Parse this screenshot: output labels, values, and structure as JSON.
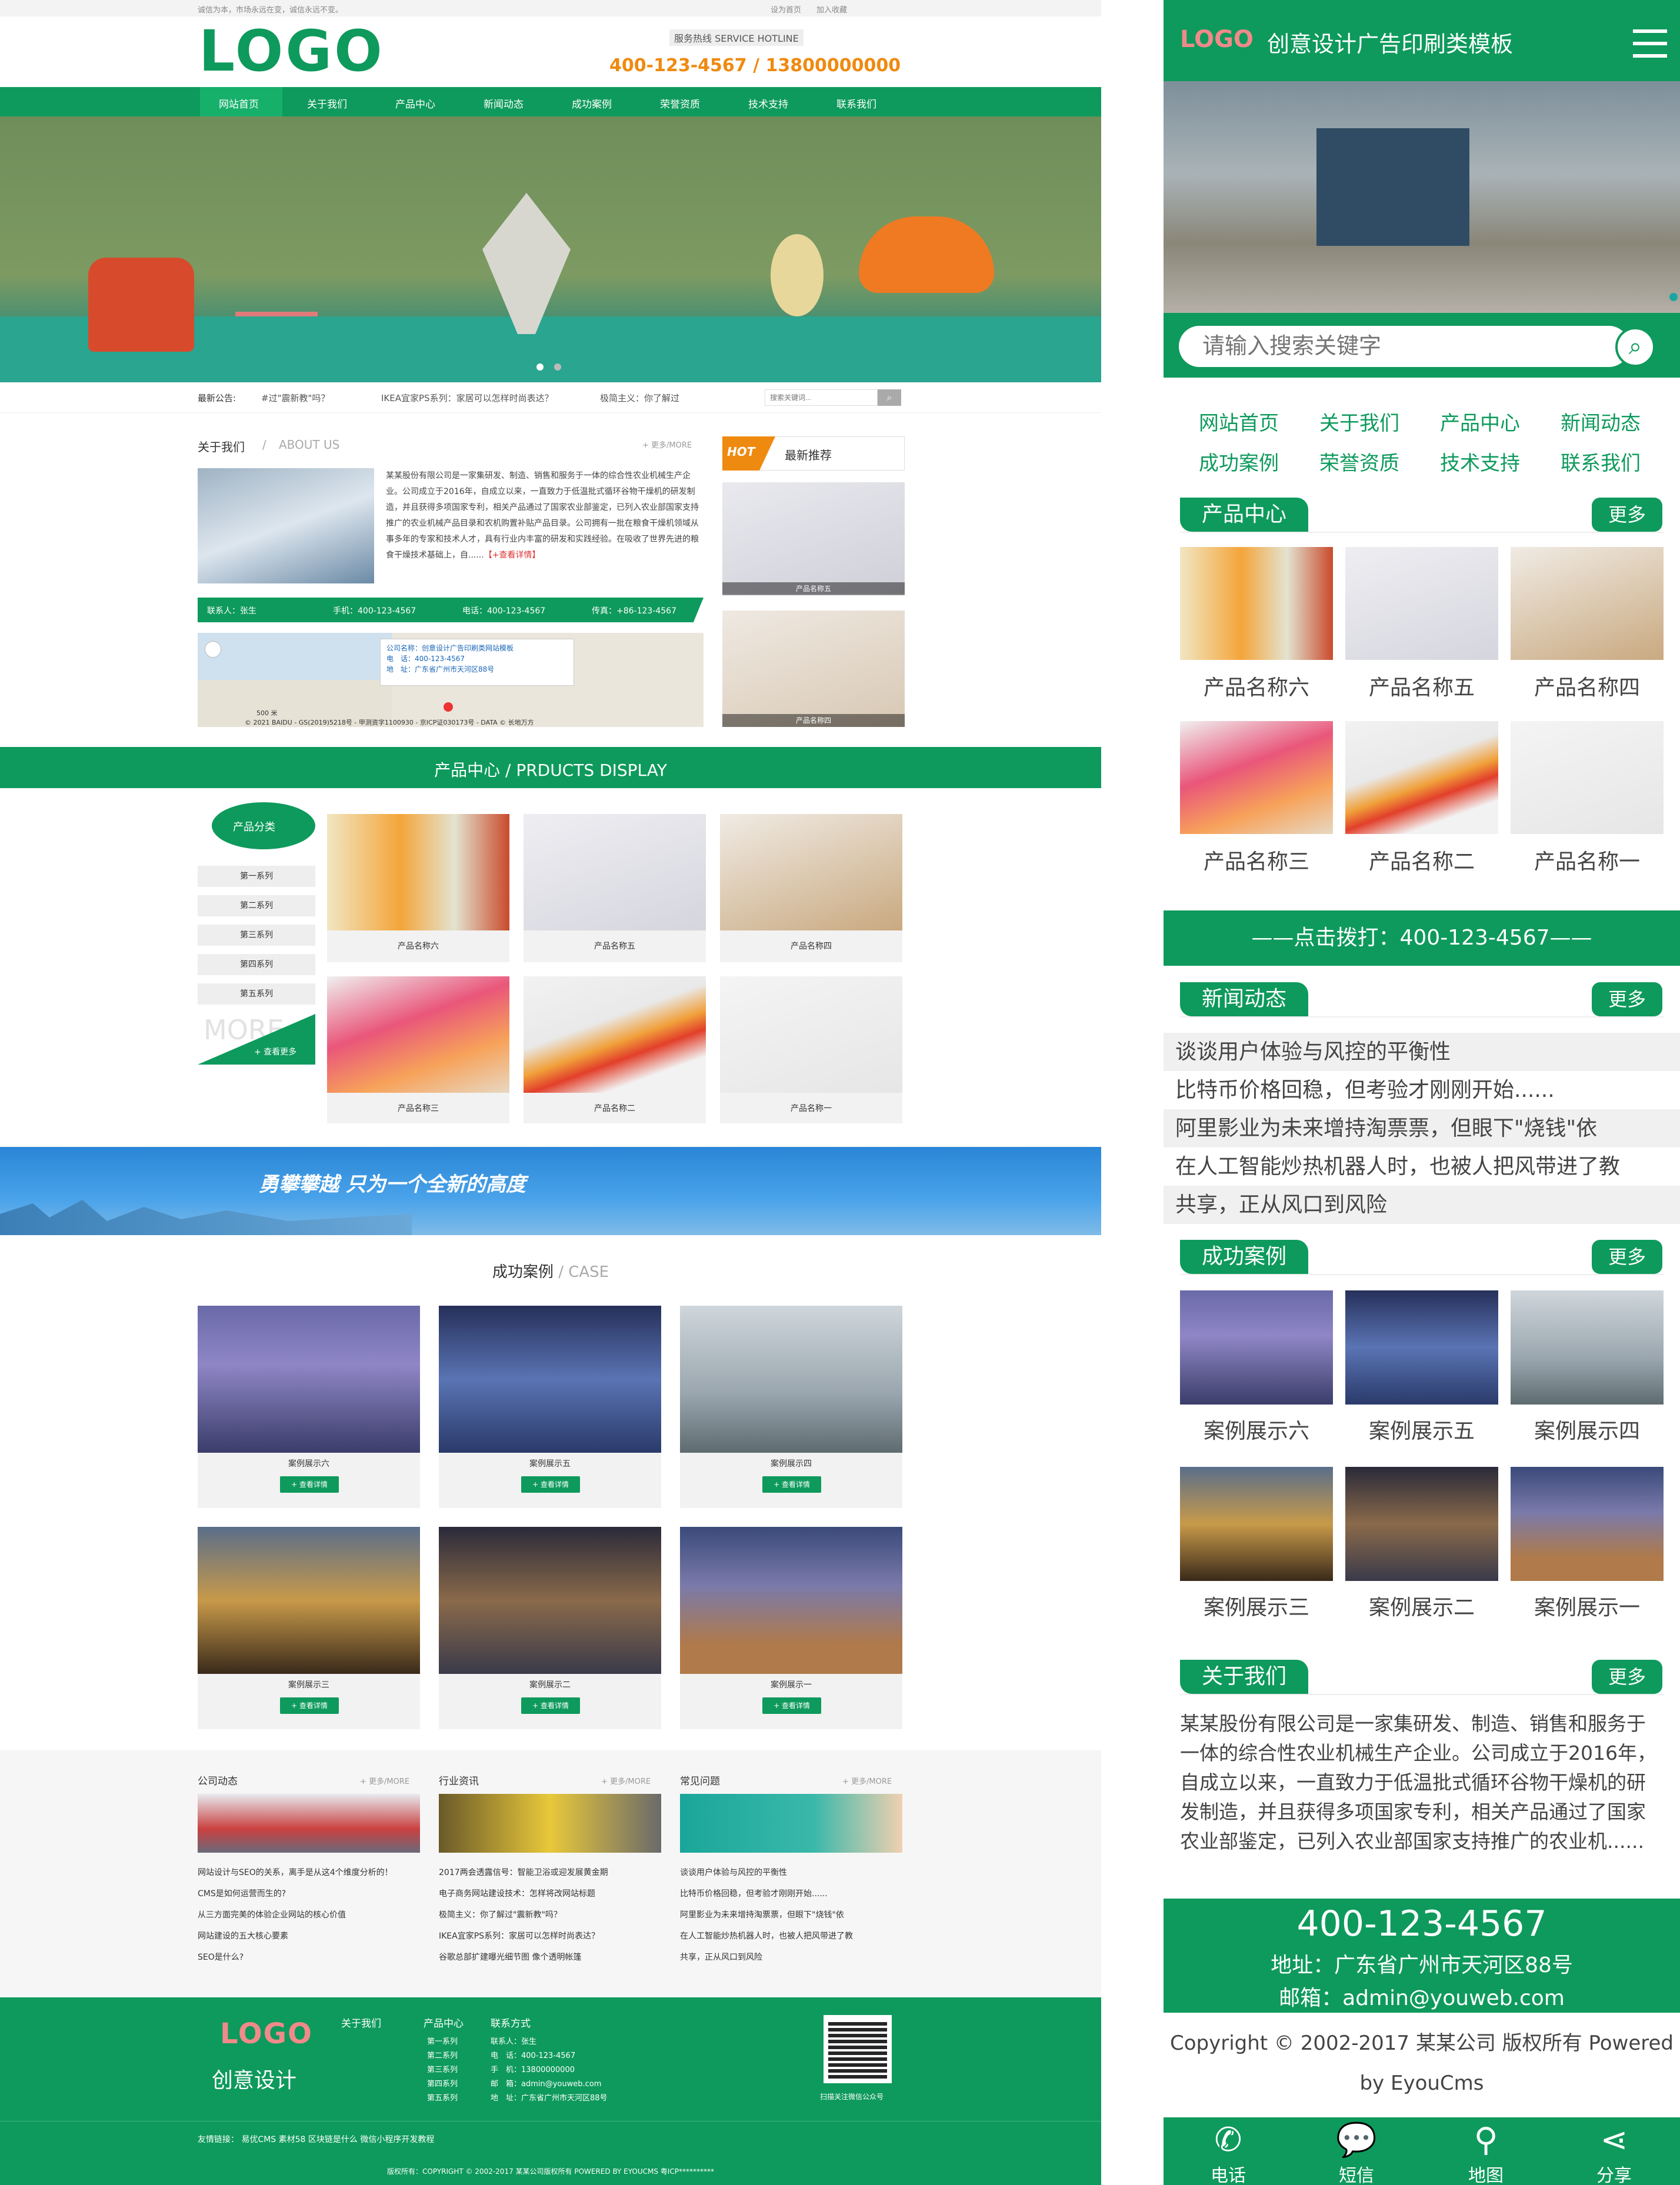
{
  "topbar": {
    "left": "诚信为本，市场永远在变，诚信永远不变。",
    "links": [
      "设为首页",
      "加入收藏"
    ]
  },
  "header": {
    "logo": "LOGO",
    "hotline_label": "服务热线 SERVICE HOTLINE",
    "hotline": "400-123-4567 / 13800000000"
  },
  "nav": [
    "网站首页",
    "关于我们",
    "产品中心",
    "新闻动态",
    "成功案例",
    "荣誉资质",
    "技术支持",
    "联系我们"
  ],
  "notice": {
    "label": "最新公告:",
    "items": [
      "#过\"震新教\"吗？",
      "IKEA宜家PS系列：家居可以怎样时尚表达？",
      "极简主义：你了解过"
    ],
    "search_placeholder": "搜索关键词..."
  },
  "about": {
    "title": "关于我们",
    "sep": "/",
    "title_en": "ABOUT US",
    "more": "+ 更多/MORE",
    "text": "某某股份有限公司是一家集研发、制造、销售和服务于一体的综合性农业机械生产企业。公司成立于2016年，自成立以来，一直致力于低温批式循环谷物干燥机的研发制造，并且获得多项国家专利，相关产品通过了国家农业部鉴定，已列入农业部国家支持推广的农业机械产品目录和农机购置补贴产品目录。公司拥有一批在粮食干燥机领域从事多年的专家和技术人才，具有行业内丰富的研发和实践经验。在吸收了世界先进的粮食干燥技术基础上，自......",
    "detail": "【+查看详情】",
    "contacts": [
      "联系人：张生",
      "手机：400-123-4567",
      "电话：400-123-4567",
      "传真：+86-123-4567"
    ]
  },
  "map": {
    "name": "公司名称：创意设计广告印刷类网站模板",
    "tel": "电　话：400-123-4567",
    "addr": "地　址：广东省广州市天河区88号",
    "copyright": "© 2021 BAIDU - GS(2019)5218号 - 甲测资字1100930 - 京ICP证030173号 - DATA © 长地万方",
    "scale": "500 米"
  },
  "hot": {
    "badge": "HOT",
    "title": "最新推荐",
    "items": [
      "产品名称五",
      "产品名称四"
    ]
  },
  "products": {
    "banner": "产品中心 / PRDUCTS DISPLAY",
    "cat_title": "产品分类",
    "cats": [
      "第一系列",
      "第二系列",
      "第三系列",
      "第四系列",
      "第五系列"
    ],
    "more_ghost": "MORE",
    "more": "+ 查看更多",
    "items": [
      "产品名称六",
      "产品名称五",
      "产品名称四",
      "产品名称三",
      "产品名称二",
      "产品名称一"
    ]
  },
  "slogan": "勇攀攀越  只为一个全新的高度",
  "cases": {
    "title": "成功案例",
    "title_en": "/ CASE",
    "detail": "+ 查看详情",
    "items": [
      "案例展示六",
      "案例展示五",
      "案例展示四",
      "案例展示三",
      "案例展示二",
      "案例展示一"
    ]
  },
  "news": {
    "cols": [
      {
        "title": "公司动态",
        "more": "+ 更多/MORE",
        "items": [
          "网站设计与SEO的关系，离手是从这4个维度分析的！",
          "CMS是如何运营而生的?",
          "从三方面完美的体验企业网站的核心价值",
          "网站建设的五大核心要素",
          "SEO是什么?"
        ]
      },
      {
        "title": "行业资讯",
        "more": "+ 更多/MORE",
        "items": [
          "2017两会透露信号：智能卫浴或迎发展黄金期",
          "电子商务网站建设技术：怎样将改网站标题",
          "极简主义：你了解过\"震新教\"吗？",
          "IKEA宜家PS系列：家居可以怎样时尚表达？",
          "谷歌总部扩建曝光细节图 像个透明帐篷"
        ]
      },
      {
        "title": "常见问题",
        "more": "+ 更多/MORE",
        "items": [
          "谈谈用户体验与风控的平衡性",
          "比特币价格回稳，但考验才刚刚开始......",
          "阿里影业为未来增持淘票票，但眼下\"烧钱\"依",
          "在人工智能炒热机器人时，也被人把风带进了教",
          "共享，正从风口到风险"
        ]
      }
    ]
  },
  "footer": {
    "logo": "LOGO",
    "brand": "创意设计",
    "col1": "关于我们",
    "col2": "产品中心",
    "col2_items": [
      "第一系列",
      "第二系列",
      "第三系列",
      "第四系列",
      "第五系列"
    ],
    "col3": "联系方式",
    "col3_items": [
      "联系人：张生",
      "电　话：400-123-4567",
      "手　机：13800000000",
      "邮　箱：admin@youweb.com",
      "地　址：广东省广州市天河区88号"
    ],
    "qr_label": "扫描关注微信公众号",
    "links": "友情链接：  易优CMS  素材58  区块链是什么  微信小程序开发教程",
    "copyright": "版权所有：COPYRIGHT © 2002-2017 某某公司版权所有 POWERED BY EYOUCMS    粤ICP**********"
  },
  "m": {
    "title": "创意设计广告印刷类模板",
    "logo": "LOGO",
    "search_placeholder": "请输入搜索关键字",
    "nav": [
      "网站首页",
      "关于我们",
      "产品中心",
      "新闻动态",
      "成功案例",
      "荣誉资质",
      "技术支持",
      "联系我们"
    ],
    "more": "更多",
    "prod_title": "产品中心",
    "prods": [
      "产品名称六",
      "产品名称五",
      "产品名称四",
      "产品名称三",
      "产品名称二",
      "产品名称一"
    ],
    "call": "——点击拨打：400-123-4567——",
    "news_title": "新闻动态",
    "news": [
      "谈谈用户体验与风控的平衡性",
      "比特币价格回稳，但考验才刚刚开始......",
      "阿里影业为未来增持淘票票，但眼下\"烧钱\"依",
      "在人工智能炒热机器人时，也被人把风带进了教",
      "共享，正从风口到风险"
    ],
    "case_title": "成功案例",
    "cases": [
      "案例展示六",
      "案例展示五",
      "案例展示四",
      "案例展示三",
      "案例展示二",
      "案例展示一"
    ],
    "about_title": "关于我们",
    "about": "某某股份有限公司是一家集研发、制造、销售和服务于一体的综合性农业机械生产企业。公司成立于2016年，自成立以来，一直致力于低温批式循环谷物干燥机的研发制造，并且获得多项国家专利，相关产品通过了国家农业部鉴定，已列入农业部国家支持推广的农业机......",
    "phone": "400-123-4567",
    "addr": "地址：广东省广州市天河区88号",
    "mail": "邮箱：admin@youweb.com",
    "copy": "Copyright © 2002-2017 某某公司 版权所有 Powered by EyouCms",
    "bottom": [
      "电话",
      "短信",
      "地图",
      "分享"
    ]
  }
}
